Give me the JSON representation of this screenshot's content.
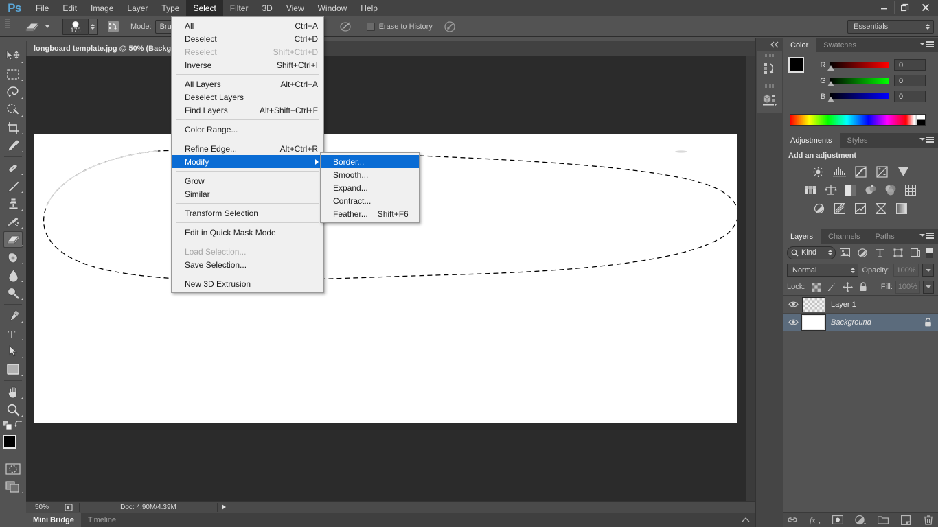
{
  "app": {
    "logo": "Ps",
    "menus": [
      "File",
      "Edit",
      "Image",
      "Layer",
      "Type",
      "Select",
      "Filter",
      "3D",
      "View",
      "Window",
      "Help"
    ],
    "active_menu": "Select",
    "window_controls": {
      "minimize": "–",
      "restore": "❐",
      "close": "✕"
    }
  },
  "options_bar": {
    "tool_icon": "eraser-icon",
    "brush_size": "176",
    "mode_label": "Mode:",
    "mode_value": "Brush",
    "erase_to_history_label": "Erase to History",
    "airbrush_icon": "airbrush-icon",
    "tablet_pressure_icon": "tablet-pressure-icon",
    "workspace_selector": "Essentials"
  },
  "document": {
    "tab_title": "longboard template.jpg @ 50% (Backg",
    "zoom": "50%",
    "doc_info": "Doc: 4.90M/4.39M"
  },
  "select_menu": {
    "groups": [
      [
        {
          "label": "All",
          "shortcut": "Ctrl+A",
          "disabled": false
        },
        {
          "label": "Deselect",
          "shortcut": "Ctrl+D",
          "disabled": false
        },
        {
          "label": "Reselect",
          "shortcut": "Shift+Ctrl+D",
          "disabled": true
        },
        {
          "label": "Inverse",
          "shortcut": "Shift+Ctrl+I",
          "disabled": false
        }
      ],
      [
        {
          "label": "All Layers",
          "shortcut": "Alt+Ctrl+A",
          "disabled": false
        },
        {
          "label": "Deselect Layers",
          "shortcut": "",
          "disabled": false
        },
        {
          "label": "Find Layers",
          "shortcut": "Alt+Shift+Ctrl+F",
          "disabled": false
        }
      ],
      [
        {
          "label": "Color Range...",
          "shortcut": "",
          "disabled": false
        }
      ],
      [
        {
          "label": "Refine Edge...",
          "shortcut": "Alt+Ctrl+R",
          "disabled": false
        },
        {
          "label": "Modify",
          "shortcut": "",
          "disabled": false,
          "submenu": true,
          "highlighted": true
        }
      ],
      [
        {
          "label": "Grow",
          "shortcut": "",
          "disabled": false
        },
        {
          "label": "Similar",
          "shortcut": "",
          "disabled": false
        }
      ],
      [
        {
          "label": "Transform Selection",
          "shortcut": "",
          "disabled": false
        }
      ],
      [
        {
          "label": "Edit in Quick Mask Mode",
          "shortcut": "",
          "disabled": false
        }
      ],
      [
        {
          "label": "Load Selection...",
          "shortcut": "",
          "disabled": true
        },
        {
          "label": "Save Selection...",
          "shortcut": "",
          "disabled": false
        }
      ],
      [
        {
          "label": "New 3D Extrusion",
          "shortcut": "",
          "disabled": false
        }
      ]
    ]
  },
  "modify_submenu": {
    "items": [
      {
        "label": "Border...",
        "shortcut": "",
        "highlighted": true
      },
      {
        "label": "Smooth...",
        "shortcut": "",
        "highlighted": false
      },
      {
        "label": "Expand...",
        "shortcut": "",
        "highlighted": false
      },
      {
        "label": "Contract...",
        "shortcut": "",
        "highlighted": false
      },
      {
        "label": "Feather...",
        "shortcut": "Shift+F6",
        "highlighted": false
      }
    ]
  },
  "toolbox": {
    "tools": [
      {
        "name": "move-tool",
        "selected": false
      },
      {
        "name": "rectangular-marquee-tool",
        "selected": false
      },
      {
        "name": "lasso-tool",
        "selected": false
      },
      {
        "name": "quick-selection-tool",
        "selected": false
      },
      {
        "name": "crop-tool",
        "selected": false
      },
      {
        "name": "eyedropper-tool",
        "selected": false
      },
      {
        "name": "spot-healing-brush-tool",
        "selected": false
      },
      {
        "name": "brush-tool",
        "selected": false
      },
      {
        "name": "clone-stamp-tool",
        "selected": false
      },
      {
        "name": "history-brush-tool",
        "selected": false
      },
      {
        "name": "eraser-tool",
        "selected": true
      },
      {
        "name": "gradient-tool",
        "selected": false
      },
      {
        "name": "blur-tool",
        "selected": false
      },
      {
        "name": "dodge-tool",
        "selected": false
      },
      {
        "name": "pen-tool",
        "selected": false
      },
      {
        "name": "horizontal-type-tool",
        "selected": false
      },
      {
        "name": "path-selection-tool",
        "selected": false
      },
      {
        "name": "rectangle-tool",
        "selected": false
      },
      {
        "name": "hand-tool",
        "selected": false
      },
      {
        "name": "zoom-tool",
        "selected": false
      }
    ],
    "foreground_color": "#000000",
    "background_color": "#ffffff"
  },
  "color_panel": {
    "tabs": [
      "Color",
      "Swatches"
    ],
    "active_tab": "Color",
    "channels": [
      {
        "label": "R",
        "value": "0",
        "color": "#ff0000"
      },
      {
        "label": "G",
        "value": "0",
        "color": "#00ff00"
      },
      {
        "label": "B",
        "value": "0",
        "color": "#0000ff"
      }
    ]
  },
  "adjustments_panel": {
    "tabs": [
      "Adjustments",
      "Styles"
    ],
    "active_tab": "Adjustments",
    "heading": "Add an adjustment",
    "row1": [
      "brightness-contrast-icon",
      "levels-icon",
      "curves-icon",
      "exposure-icon",
      "vibrance-icon"
    ],
    "row2": [
      "hue-saturation-icon",
      "color-balance-icon",
      "black-white-icon",
      "photo-filter-icon",
      "channel-mixer-icon",
      "color-lookup-icon"
    ],
    "row3": [
      "invert-icon",
      "posterize-icon",
      "threshold-icon",
      "selective-color-icon",
      "gradient-map-icon"
    ]
  },
  "layers_panel": {
    "tabs": [
      "Layers",
      "Channels",
      "Paths"
    ],
    "active_tab": "Layers",
    "filter_kind": "Kind",
    "filter_icons": [
      "filter-pixel-icon",
      "filter-adjustment-icon",
      "filter-type-icon",
      "filter-shape-icon",
      "filter-smart-object-icon",
      "filter-toggle-icon"
    ],
    "blend_mode": "Normal",
    "opacity_label": "Opacity:",
    "opacity_value": "100%",
    "lock_label": "Lock:",
    "lock_icons": [
      "lock-transparent-pixels-icon",
      "lock-image-pixels-icon",
      "lock-position-icon",
      "lock-all-icon"
    ],
    "fill_label": "Fill:",
    "fill_value": "100%",
    "layers": [
      {
        "name": "Layer 1",
        "visible": true,
        "selected": false,
        "locked": false,
        "italic": false,
        "thumb": "checker"
      },
      {
        "name": "Background",
        "visible": true,
        "selected": true,
        "locked": true,
        "italic": true,
        "thumb": "white"
      }
    ],
    "footer_icons": [
      "link-layers-icon",
      "layer-style-icon",
      "layer-mask-icon",
      "new-fill-adjustment-icon",
      "new-group-icon",
      "new-layer-icon",
      "delete-layer-icon"
    ]
  },
  "right_rail": {
    "collapse_icon": "collapse-panels-icon",
    "cards": [
      "history-icon",
      "3d-icon"
    ]
  },
  "bottom_dock": {
    "tabs": [
      {
        "label": "Mini Bridge",
        "active": true
      },
      {
        "label": "Timeline",
        "active": false
      }
    ]
  }
}
